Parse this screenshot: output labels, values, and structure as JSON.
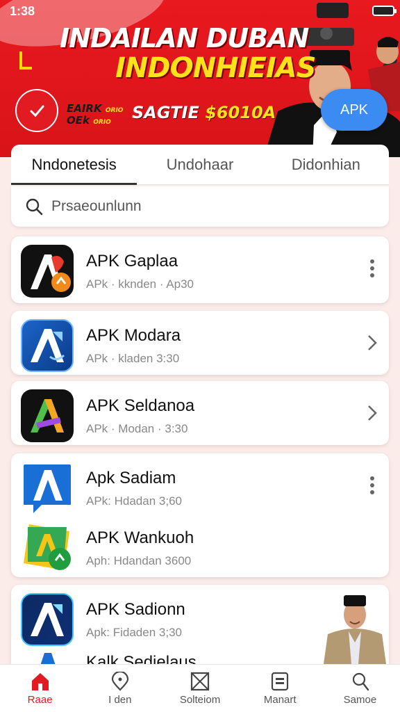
{
  "status_bar": {
    "time": "1:38"
  },
  "banner": {
    "headline_line1": "INDAILAN DUBAN",
    "headline_line2": "INDONHIEIAS",
    "promo_small_1": "EAIRK",
    "promo_small_2": "OEk",
    "promo_small_3": "ORIO",
    "promo_small_4": "ORIO",
    "promo_main_1": "SAGTIE",
    "promo_main_2": "$6010A",
    "cta_label": "APK",
    "accent_color": "#e21b22",
    "highlight_color": "#ffe21a",
    "cta_color": "#3b8bf2"
  },
  "tabs": [
    {
      "label": "Nndonetesis",
      "active": true
    },
    {
      "label": "Undohaar",
      "active": false
    },
    {
      "label": "Didonhian",
      "active": false
    }
  ],
  "search": {
    "placeholder": "Prsaeounlunn",
    "icon": "search-icon"
  },
  "apps": [
    {
      "title": "APK Gaplaa",
      "subtitle": "APk  · kknden · Ap30",
      "action": "more-vert-icon"
    },
    {
      "title": "APK Modara",
      "subtitle": "APk  · kladen  3:30",
      "action": "chevron-right-icon"
    },
    {
      "title": "APK Seldanoa",
      "subtitle": "APk  · Modan · 3:30",
      "action": "chevron-right-icon"
    },
    {
      "title": "Apk Sadiam",
      "subtitle": "APk: Hdadan  3;60",
      "action": "more-vert-icon"
    },
    {
      "title": "APK Wankuoh",
      "subtitle": "Aph: Hdandan  3600",
      "action": ""
    },
    {
      "title": "APK Sadionn",
      "subtitle": "Apk: Fidaden  3;30",
      "action": ""
    },
    {
      "title": "Kalk Sedielaus",
      "subtitle": "",
      "action": ""
    }
  ],
  "bottom_nav": [
    {
      "label": "Raae",
      "icon": "home-icon",
      "active": true
    },
    {
      "label": "I den",
      "icon": "location-icon",
      "active": false
    },
    {
      "label": "Solteiom",
      "icon": "mail-box-icon",
      "active": false
    },
    {
      "label": "Manart",
      "icon": "document-icon",
      "active": false
    },
    {
      "label": "Samoe",
      "icon": "profile-icon",
      "active": false
    }
  ]
}
